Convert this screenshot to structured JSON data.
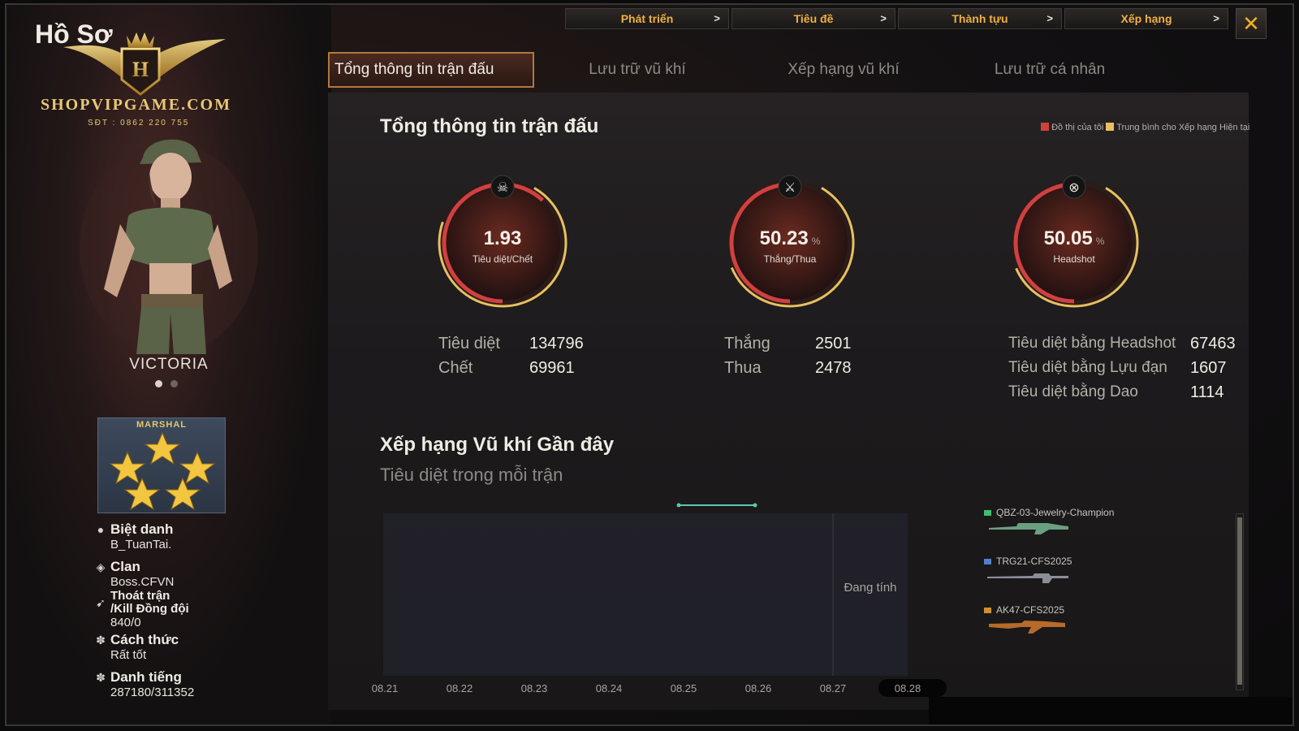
{
  "app": {
    "title": "Hồ Sơ",
    "logo_letter": "H",
    "shop_name": "SHOPVIPGAME.COM",
    "shop_phone": "SĐT : 0862 220 755",
    "close_icon": "close-icon"
  },
  "top_menu": [
    {
      "label": "Phát triển",
      "arrow": ">"
    },
    {
      "label": "Tiêu đề",
      "arrow": ">"
    },
    {
      "label": "Thành tựu",
      "arrow": ">"
    },
    {
      "label": "Xếp hạng",
      "arrow": ">"
    }
  ],
  "tabs": [
    {
      "label": "Tổng thông tin trận đấu",
      "active": true
    },
    {
      "label": "Lưu trữ vũ khí",
      "active": false
    },
    {
      "label": "Xếp hạng vũ khí",
      "active": false
    },
    {
      "label": "Lưu trữ cá nhân",
      "active": false
    }
  ],
  "character": {
    "name": "VICTORIA",
    "rank_title": "MARSHAL"
  },
  "profile": {
    "nickname_label": "Biệt danh",
    "nickname": "B_TuanTai.",
    "clan_label": "Clan",
    "clan": "Boss.CFVN",
    "quit_label_1": "Thoát trận",
    "quit_label_2": "/Kill Đồng đội",
    "quit": "840/0",
    "manner_label": "Cách thức",
    "manner": "Rất tốt",
    "fame_label": "Danh tiếng",
    "fame": "287180/311352"
  },
  "main": {
    "title": "Tổng thông tin trận đấu",
    "legend_mine": "Đồ thị của tôi",
    "legend_avg": "Trung bình cho Xếp hạng Hiện tại",
    "colors": {
      "mine": "#d04040",
      "avg": "#e8c060"
    }
  },
  "gauges": [
    {
      "value": "1.93",
      "unit": "",
      "label": "Tiêu diệt/Chết",
      "icon": "skull-icon",
      "fill": 0.62
    },
    {
      "value": "50.23",
      "unit": "%",
      "label": "Thắng/Thua",
      "icon": "crossed-swords-icon",
      "fill": 0.5023
    },
    {
      "value": "50.05",
      "unit": "%",
      "label": "Headshot",
      "icon": "target-icon",
      "fill": 0.5005
    }
  ],
  "stats": {
    "kills_label": "Tiêu diệt",
    "kills": "134796",
    "deaths_label": "Chết",
    "deaths": "69961",
    "wins_label": "Thắng",
    "wins": "2501",
    "losses_label": "Thua",
    "losses": "2478",
    "hs_label": "Tiêu diệt bằng Headshot",
    "hs": "67463",
    "grenade_label": "Tiêu diệt bằng Lựu đạn",
    "grenade": "1607",
    "knife_label": "Tiêu diệt bằng Dao",
    "knife": "1114"
  },
  "recent": {
    "title": "Xếp hạng Vũ khí Gần đây",
    "subtitle": "Tiêu diệt trong mỗi trận",
    "pending": "Đang tính"
  },
  "chart_data": {
    "type": "line",
    "title": "Xếp hạng Vũ khí Gần đây",
    "subtitle": "Tiêu diệt trong mỗi trận",
    "categories": [
      "08.21",
      "08.22",
      "08.23",
      "08.24",
      "08.25",
      "08.26",
      "08.27",
      "08.28"
    ],
    "highlighted": "08.28",
    "series": [
      {
        "name": "QBZ-03-Jewelry-Champion",
        "color": "#3cc070"
      },
      {
        "name": "TRG21-CFS2025",
        "color": "#5080d0"
      },
      {
        "name": "AK47-CFS2025",
        "color": "#d09030"
      }
    ]
  },
  "weapons": [
    {
      "name": "QBZ-03-Jewelry-Champion",
      "color": "#3cc070"
    },
    {
      "name": "TRG21-CFS2025",
      "color": "#5080d0"
    },
    {
      "name": "AK47-CFS2025",
      "color": "#d09030"
    }
  ]
}
